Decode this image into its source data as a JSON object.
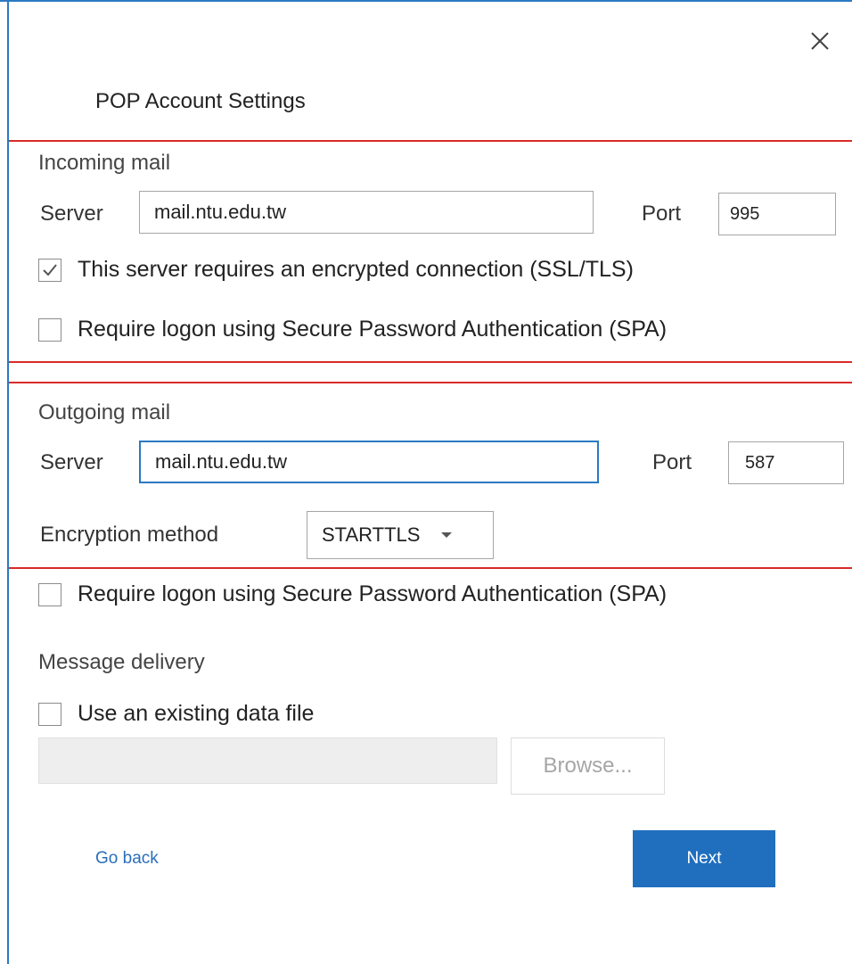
{
  "dialog": {
    "title": "POP Account Settings",
    "close_icon": "close-icon",
    "accent_color": "#2b79c2",
    "highlight_color": "#d92a2a"
  },
  "incoming": {
    "section_label": "Incoming mail",
    "server_label": "Server",
    "server_value": "mail.ntu.edu.tw",
    "port_label": "Port",
    "port_value": "995",
    "ssl_label": "This server requires an encrypted connection (SSL/TLS)",
    "ssl_checked": true,
    "spa_label": "Require logon using Secure Password Authentication (SPA)",
    "spa_checked": false
  },
  "outgoing": {
    "section_label": "Outgoing mail",
    "server_label": "Server",
    "server_value": "mail.ntu.edu.tw",
    "port_label": "Port",
    "port_value": "587",
    "encryption_label": "Encryption method",
    "encryption_value": "STARTTLS",
    "spa_label": "Require logon using Secure Password Authentication (SPA)",
    "spa_checked": false
  },
  "delivery": {
    "section_label": "Message delivery",
    "existing_file_label": "Use an existing data file",
    "existing_file_checked": false,
    "file_path_value": "",
    "browse_label": "Browse..."
  },
  "footer": {
    "back_label": "Go back",
    "next_label": "Next"
  }
}
